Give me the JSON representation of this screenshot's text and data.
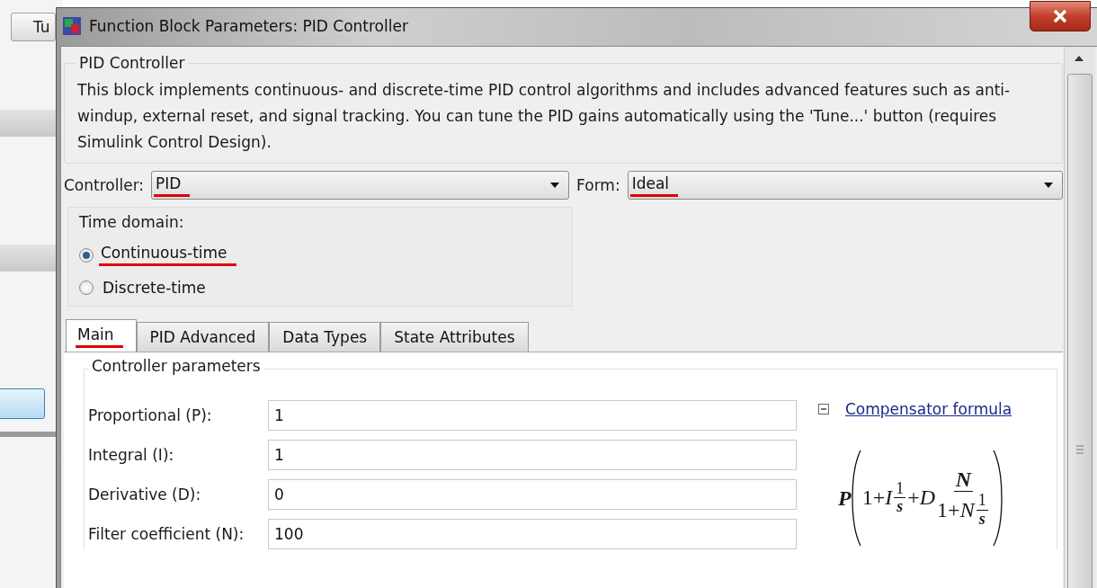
{
  "background_window": {
    "button_label": "Tu"
  },
  "window": {
    "title": "Function Block Parameters: PID Controller"
  },
  "group": {
    "title": "PID Controller",
    "description": "This block implements continuous- and discrete-time PID control algorithms and includes advanced features such as anti-windup, external reset, and signal tracking. You can tune the PID gains automatically using the 'Tune...' button (requires Simulink Control Design)."
  },
  "controller": {
    "label": "Controller:",
    "value": "PID",
    "underlined": true
  },
  "form": {
    "label": "Form:",
    "value": "Ideal",
    "underlined": true
  },
  "time_domain": {
    "title": "Time domain:",
    "options": [
      {
        "label": "Continuous-time",
        "selected": true,
        "underlined": true
      },
      {
        "label": "Discrete-time",
        "selected": false,
        "underlined": false
      }
    ]
  },
  "tabs": [
    {
      "label": "Main",
      "selected": true,
      "underlined": true
    },
    {
      "label": "PID Advanced",
      "selected": false,
      "underlined": false
    },
    {
      "label": "Data Types",
      "selected": false,
      "underlined": false
    },
    {
      "label": "State Attributes",
      "selected": false,
      "underlined": false
    }
  ],
  "parameters": {
    "title": "Controller parameters",
    "rows": [
      {
        "label": "Proportional (P):",
        "value": "1"
      },
      {
        "label": "Integral (I):",
        "value": "1"
      },
      {
        "label": "Derivative (D):",
        "value": "0"
      },
      {
        "label": "Filter coefficient (N):",
        "value": "100"
      }
    ]
  },
  "compensator": {
    "link": "Compensator formula",
    "expanded": true
  },
  "formula": {
    "gain": "P",
    "lead": "1+*I*",
    "i_num": "1",
    "i_den": "s",
    "plus": "+*D*",
    "d_num": "N",
    "d_den_lead": "1+*N*",
    "d_den_num": "1",
    "d_den_den": "s"
  }
}
